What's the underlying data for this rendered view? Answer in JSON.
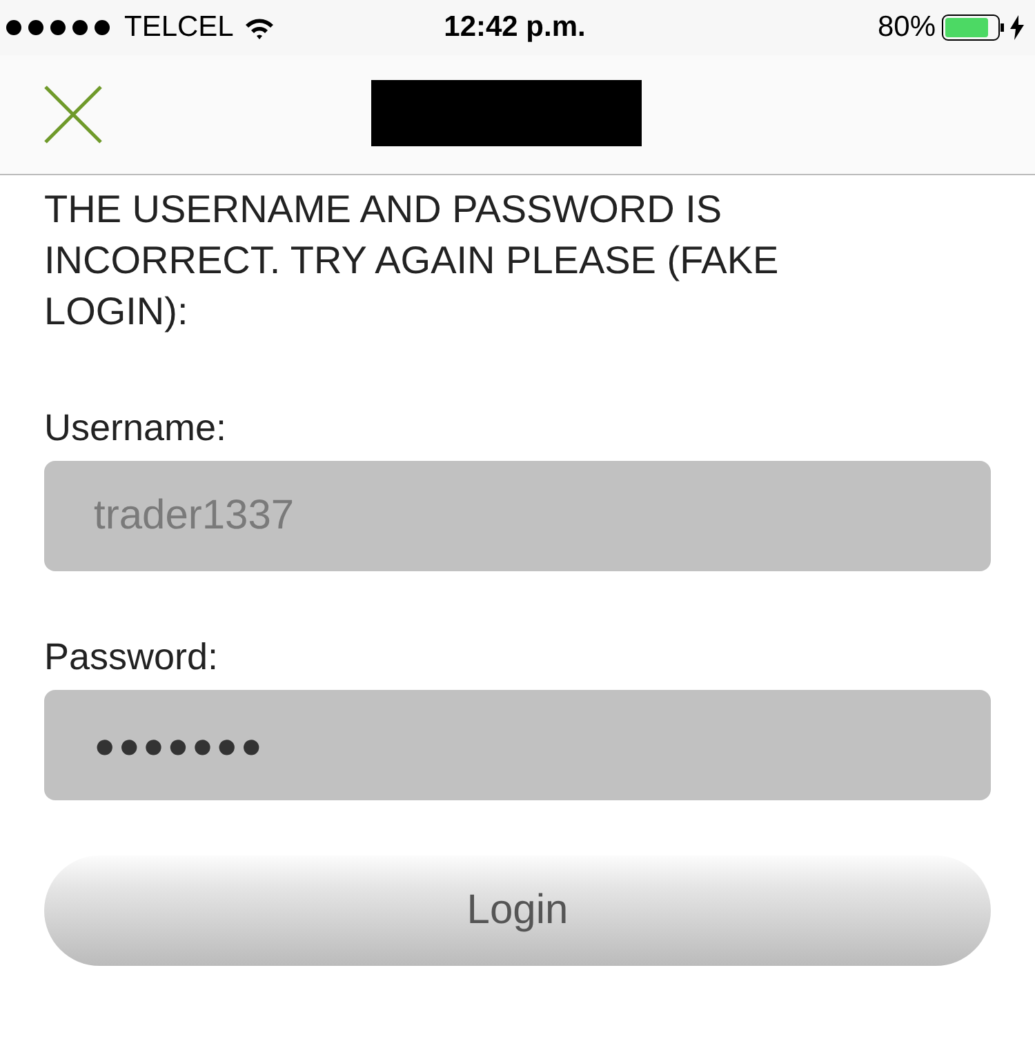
{
  "status_bar": {
    "carrier": "TELCEL",
    "time": "12:42 p.m.",
    "battery": "80%"
  },
  "message": "THE USERNAME AND PASSWORD IS INCORRECT. TRY AGAIN PLEASE (FAKE LOGIN):",
  "fields": [
    {
      "label": "Username:",
      "value": "trader1337",
      "kind": "text"
    },
    {
      "label": "Password:",
      "value": "●●●●●●●",
      "kind": "password"
    }
  ],
  "button": "Login"
}
